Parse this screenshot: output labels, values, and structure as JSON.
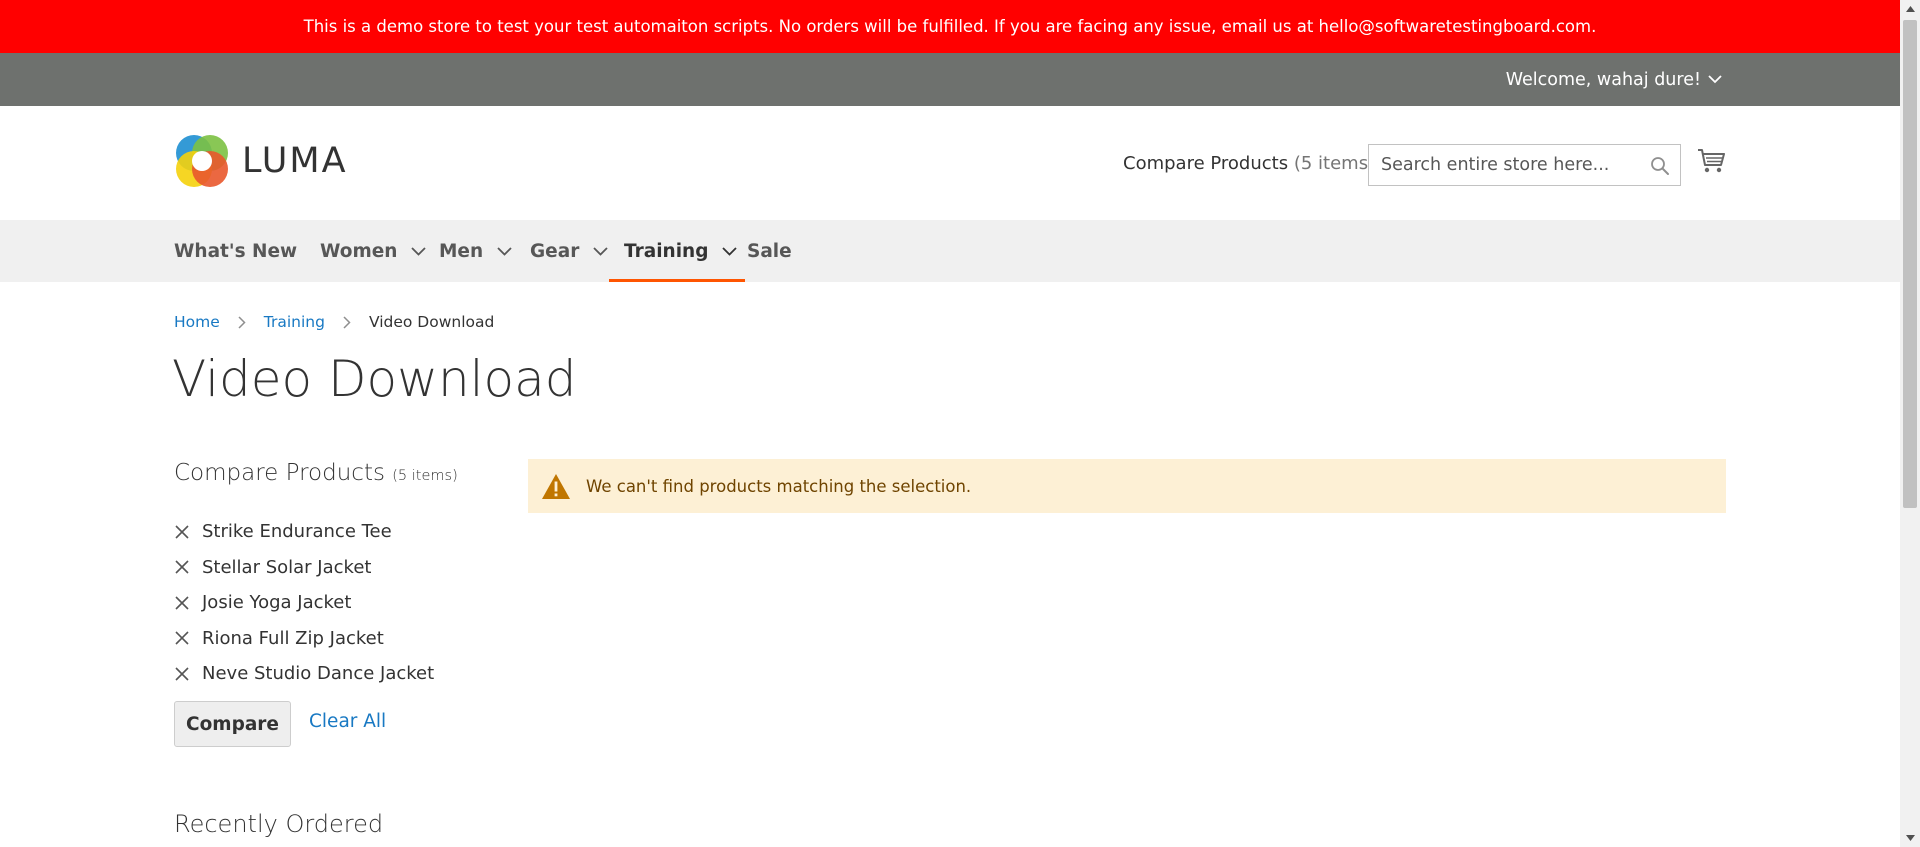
{
  "demo_notice": "This is a demo store to test your test automaiton scripts. No orders will be fulfilled. If you are facing any issue, email us at hello@softwaretestingboard.com.",
  "header_panel": {
    "welcome": "Welcome, wahaj dure!"
  },
  "header": {
    "logo_text": "LUMA",
    "compare_label": "Compare Products",
    "compare_count": "(5 items)",
    "search_placeholder": "Search entire store here..."
  },
  "nav": [
    {
      "label": "What's New"
    },
    {
      "label": "Women"
    },
    {
      "label": "Men"
    },
    {
      "label": "Gear"
    },
    {
      "label": "Training"
    },
    {
      "label": "Sale"
    }
  ],
  "breadcrumbs": {
    "home": "Home",
    "training": "Training",
    "current": "Video Download"
  },
  "page_title": "Video Download",
  "sidebar": {
    "compare_title": "Compare Products",
    "compare_count": "(5 items)",
    "items": [
      "Strike Endurance Tee",
      "Stellar Solar Jacket",
      "Josie Yoga Jacket",
      "Riona Full Zip Jacket",
      "Neve Studio Dance Jacket"
    ],
    "compare_button": "Compare",
    "clear_all": "Clear All",
    "recently_ordered": "Recently Ordered"
  },
  "message": {
    "text": "We can't find products matching the selection."
  },
  "colors": {
    "banner": "#ff0000",
    "panel": "#6e716e",
    "nav_bg": "#f0f0f0",
    "accent": "#ff5501",
    "link": "#1979c3",
    "warning_bg": "#fdf0d5",
    "warning_icon": "#c07600"
  }
}
